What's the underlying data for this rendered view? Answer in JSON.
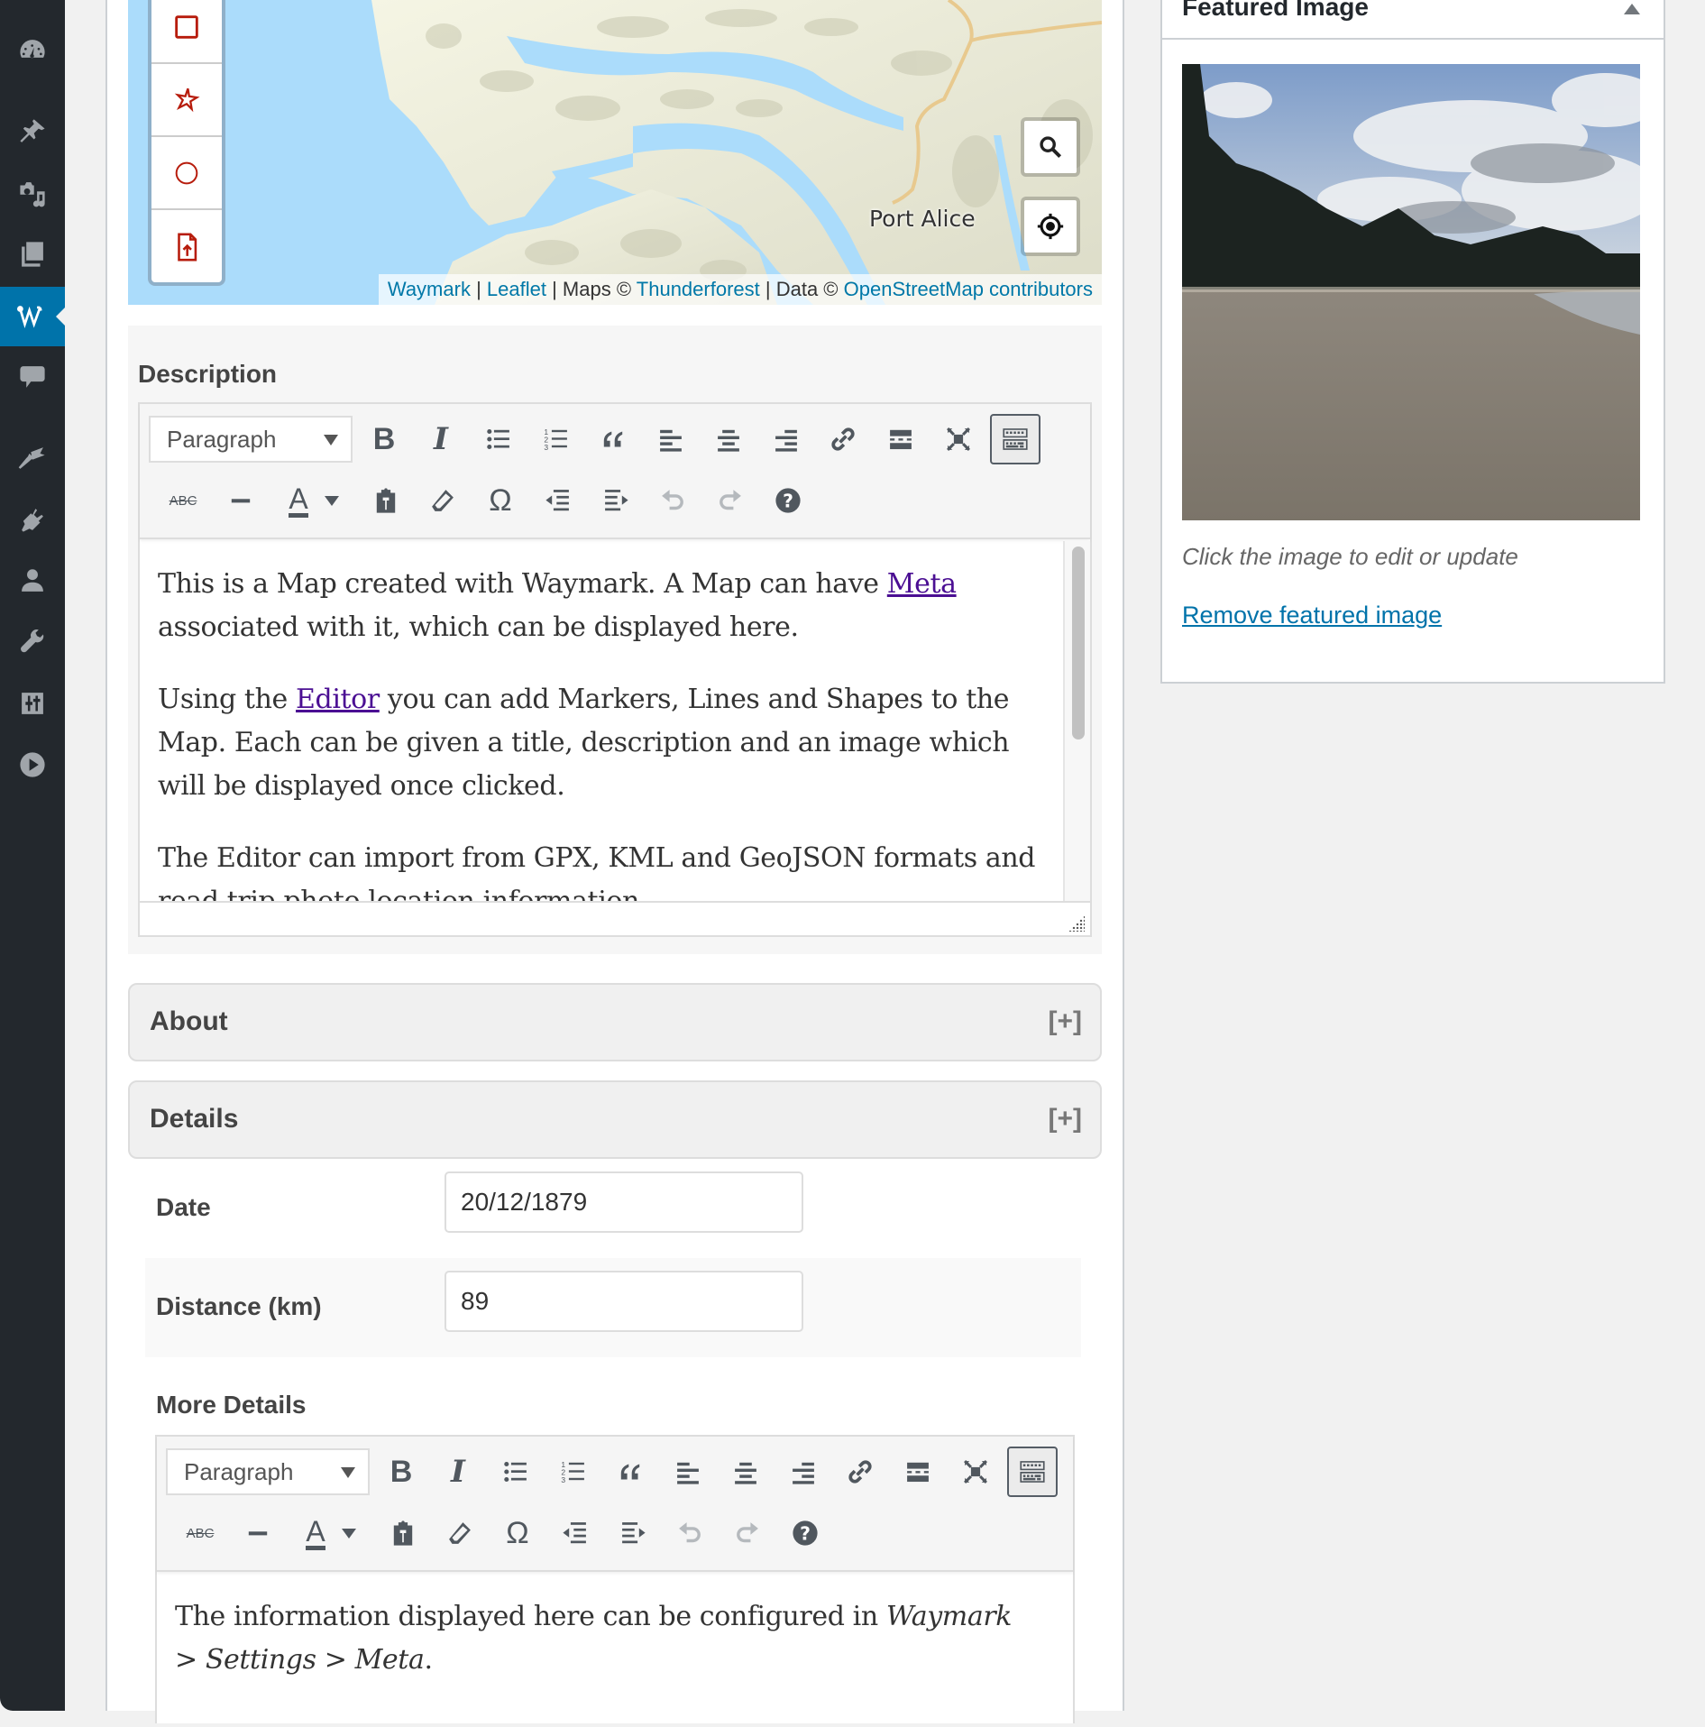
{
  "admin_menu": {
    "items": [
      {
        "name": "dashboard",
        "icon": "dashboard-icon",
        "active": false
      },
      {
        "name": "posts",
        "icon": "pin-icon",
        "active": false
      },
      {
        "name": "media",
        "icon": "media-icon",
        "active": false
      },
      {
        "name": "pages",
        "icon": "pages-icon",
        "active": false
      },
      {
        "name": "waymark",
        "icon": "waymark-icon",
        "active": true
      },
      {
        "name": "comments",
        "icon": "comment-icon",
        "active": false
      },
      {
        "name": "appearance",
        "icon": "paintbrush-icon",
        "active": false
      },
      {
        "name": "plugins",
        "icon": "plugin-icon",
        "active": false
      },
      {
        "name": "users",
        "icon": "user-icon",
        "active": false
      },
      {
        "name": "tools",
        "icon": "wrench-icon",
        "active": false
      },
      {
        "name": "settings",
        "icon": "sliders-icon",
        "active": false
      },
      {
        "name": "media-player",
        "icon": "play-icon",
        "active": false
      }
    ],
    "accent_color": "#0073aa"
  },
  "map": {
    "draw_tools": [
      "rectangle-tool",
      "marker-tool",
      "circle-tool",
      "upload-file-tool"
    ],
    "place_label": "Port Alice",
    "controls": [
      "search-icon",
      "locate-icon"
    ],
    "attribution": {
      "waymark": "Waymark",
      "sep1": "|",
      "leaflet": "Leaflet",
      "maps_text": "| Maps ©",
      "thunderforest": "Thunderforest",
      "data_text": "| Data ©",
      "osm": "OpenStreetMap contributors"
    }
  },
  "description": {
    "label": "Description",
    "format_select": "Paragraph",
    "paragraphs": {
      "p1_before": "This is a Map created with Waymark. A Map can have ",
      "p1_link": "Meta",
      "p1_after": " associated with it, which can be displayed here.",
      "p2_before": "Using the ",
      "p2_link": "Editor",
      "p2_after": " you can add Markers, Lines and Shapes to the Map. Each can be given a title, description and an image which will be displayed once clicked.",
      "p3": "The Editor can import from GPX, KML and GeoJSON formats and read trip photo location information."
    }
  },
  "toolbar": {
    "row1": [
      "bold",
      "italic",
      "bulleted-list",
      "numbered-list",
      "blockquote",
      "align-left",
      "align-center",
      "align-right",
      "link",
      "read-more",
      "fullscreen",
      "toolbar-toggle"
    ],
    "row2": [
      "strikethrough",
      "horizontal-line",
      "text-color",
      "text-color-dropdown",
      "paste-as-text",
      "clear-formatting",
      "special-character",
      "outdent",
      "indent",
      "undo",
      "redo",
      "help"
    ],
    "strike_label": "ABC",
    "bold_label": "B",
    "italic_label": "I",
    "text_color_label": "A",
    "omega_label": "Ω"
  },
  "sections": {
    "about": {
      "title": "About",
      "toggle": "[+]"
    },
    "details": {
      "title": "Details",
      "toggle": "[+]"
    }
  },
  "details": {
    "date": {
      "label": "Date",
      "value": "20/12/1879"
    },
    "distance": {
      "label": "Distance (km)",
      "value": "89"
    },
    "more_details": {
      "label": "More Details",
      "format_select": "Paragraph",
      "content_before": "The information displayed here can be configured in ",
      "content_italic": "Waymark > Settings > Meta",
      "content_after": "."
    }
  },
  "featured_image": {
    "title": "Featured Image",
    "hint": "Click the image to edit or update",
    "remove_link": "Remove featured image"
  }
}
